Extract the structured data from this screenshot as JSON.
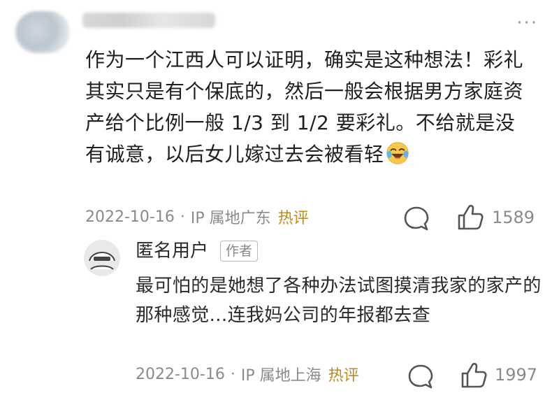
{
  "main_comment": {
    "text": "作为一个江西人可以证明，确实是这种想法！彩礼其实只是有个保底的，然后一般会根据男方家庭资产给个比例一般 1/3 到 1/2 要彩礼。不给就是没有诚意，以后女儿嫁过去会被看轻",
    "date": "2022-10-16",
    "separator": "·",
    "ip_location": "IP 属地广东",
    "hot_badge": "热评",
    "like_count": "1589"
  },
  "reply": {
    "username": "匿名用户",
    "author_tag": "作者",
    "text": "最可怕的是她想了各种办法试图摸清我家的家产的那种感觉...连我妈公司的年报都去查",
    "date": "2022-10-16",
    "separator": "·",
    "ip_location": "IP 属地上海",
    "hot_badge": "热评",
    "like_count": "1997"
  },
  "icons": {
    "more": "more-dots-icon",
    "comment": "comment-bubble-icon",
    "like": "thumbs-up-icon",
    "emoji": "laughing-tears-emoji"
  },
  "colors": {
    "hot_badge": "#c08a1a",
    "meta_text": "#8a8a8a",
    "body_text": "#1f1f1f"
  }
}
